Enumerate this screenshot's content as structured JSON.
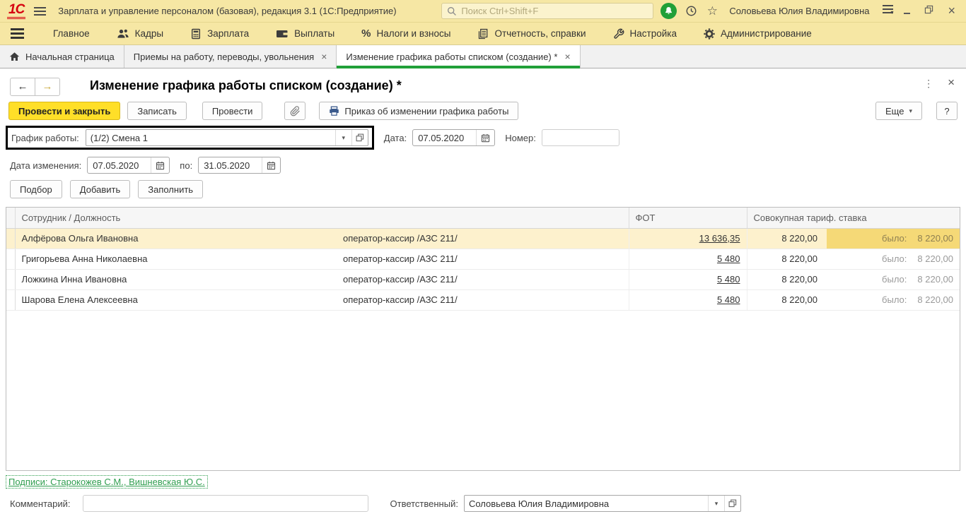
{
  "window": {
    "logo": "1С",
    "title": "Зарплата и управление персоналом (базовая), редакция 3.1  (1С:Предприятие)",
    "search_placeholder": "Поиск Ctrl+Shift+F",
    "user": "Соловьева Юлия Владимировна"
  },
  "glyphs": {
    "back": "←",
    "forward": "→",
    "caret": "▾",
    "dots": "⋮",
    "close": "×",
    "star": "☆",
    "percent": "%"
  },
  "menu": {
    "items": [
      {
        "label": "Главное",
        "icon": "none"
      },
      {
        "label": "Кадры",
        "icon": "people-icon"
      },
      {
        "label": "Зарплата",
        "icon": "calculator-icon"
      },
      {
        "label": "Выплаты",
        "icon": "wallet-icon"
      },
      {
        "label": "Налоги и взносы",
        "icon": "percent-icon"
      },
      {
        "label": "Отчетность, справки",
        "icon": "report-icon"
      },
      {
        "label": "Настройка",
        "icon": "wrench-icon"
      },
      {
        "label": "Администрирование",
        "icon": "gear-icon"
      }
    ]
  },
  "tabs": [
    {
      "label": "Начальная страница",
      "icon": "home-icon",
      "active": false,
      "closable": false
    },
    {
      "label": "Приемы на работу, переводы, увольнения",
      "active": false,
      "closable": true
    },
    {
      "label": "Изменение графика работы списком (создание) *",
      "active": true,
      "closable": true
    }
  ],
  "form": {
    "title": "Изменение графика работы списком (создание) *",
    "toolbar": {
      "post_close": "Провести и закрыть",
      "save": "Записать",
      "post": "Провести",
      "order": "Приказ об изменении графика работы",
      "more": "Еще",
      "help": "?"
    },
    "fields": {
      "schedule_label": "График работы:",
      "schedule_value": "(1/2) Смена 1",
      "date_label": "Дата:",
      "date_value": "07.05.2020",
      "number_label": "Номер:",
      "number_value": "",
      "change_date_label": "Дата изменения:",
      "change_date_from": "07.05.2020",
      "to_label": "по:",
      "change_date_to": "31.05.2020"
    },
    "actions": {
      "pick": "Подбор",
      "add": "Добавить",
      "fill": "Заполнить"
    },
    "table": {
      "headers": {
        "employee": "Сотрудник / Должность",
        "fot": "ФОТ",
        "rate": "Совокупная тариф. ставка"
      },
      "was_label": "было:",
      "rows": [
        {
          "name": "Алфёрова Ольга Ивановна",
          "position": "оператор-кассир /АЗС 211/",
          "fot": "13 636,35",
          "rate": "8 220,00",
          "was": "8 220,00"
        },
        {
          "name": "Григорьева Анна Николаевна",
          "position": "оператор-кассир /АЗС 211/",
          "fot": "5 480",
          "rate": "8 220,00",
          "was": "8 220,00"
        },
        {
          "name": "Ложкина Инна Ивановна",
          "position": "оператор-кассир /АЗС 211/",
          "fot": "5 480",
          "rate": "8 220,00",
          "was": "8 220,00"
        },
        {
          "name": "Шарова Елена Алексеевна",
          "position": "оператор-кассир /АЗС 211/",
          "fot": "5 480",
          "rate": "8 220,00",
          "was": "8 220,00"
        }
      ]
    },
    "footer": {
      "signatures": "Подписи: Старокожев С.М., Вишневская Ю.С.",
      "comment_label": "Комментарий:",
      "comment_value": "",
      "responsible_label": "Ответственный:",
      "responsible_value": "Соловьева Юлия Владимировна"
    }
  },
  "colors": {
    "bar_yellow": "#f6e7a4",
    "brand_red": "#d6000f",
    "green_accent": "#21a038",
    "primary_button": "#ffdf28",
    "selected_row": "#fdf1cd",
    "was_cell_selected": "#f5d977",
    "link_green": "#2f9e4f"
  }
}
